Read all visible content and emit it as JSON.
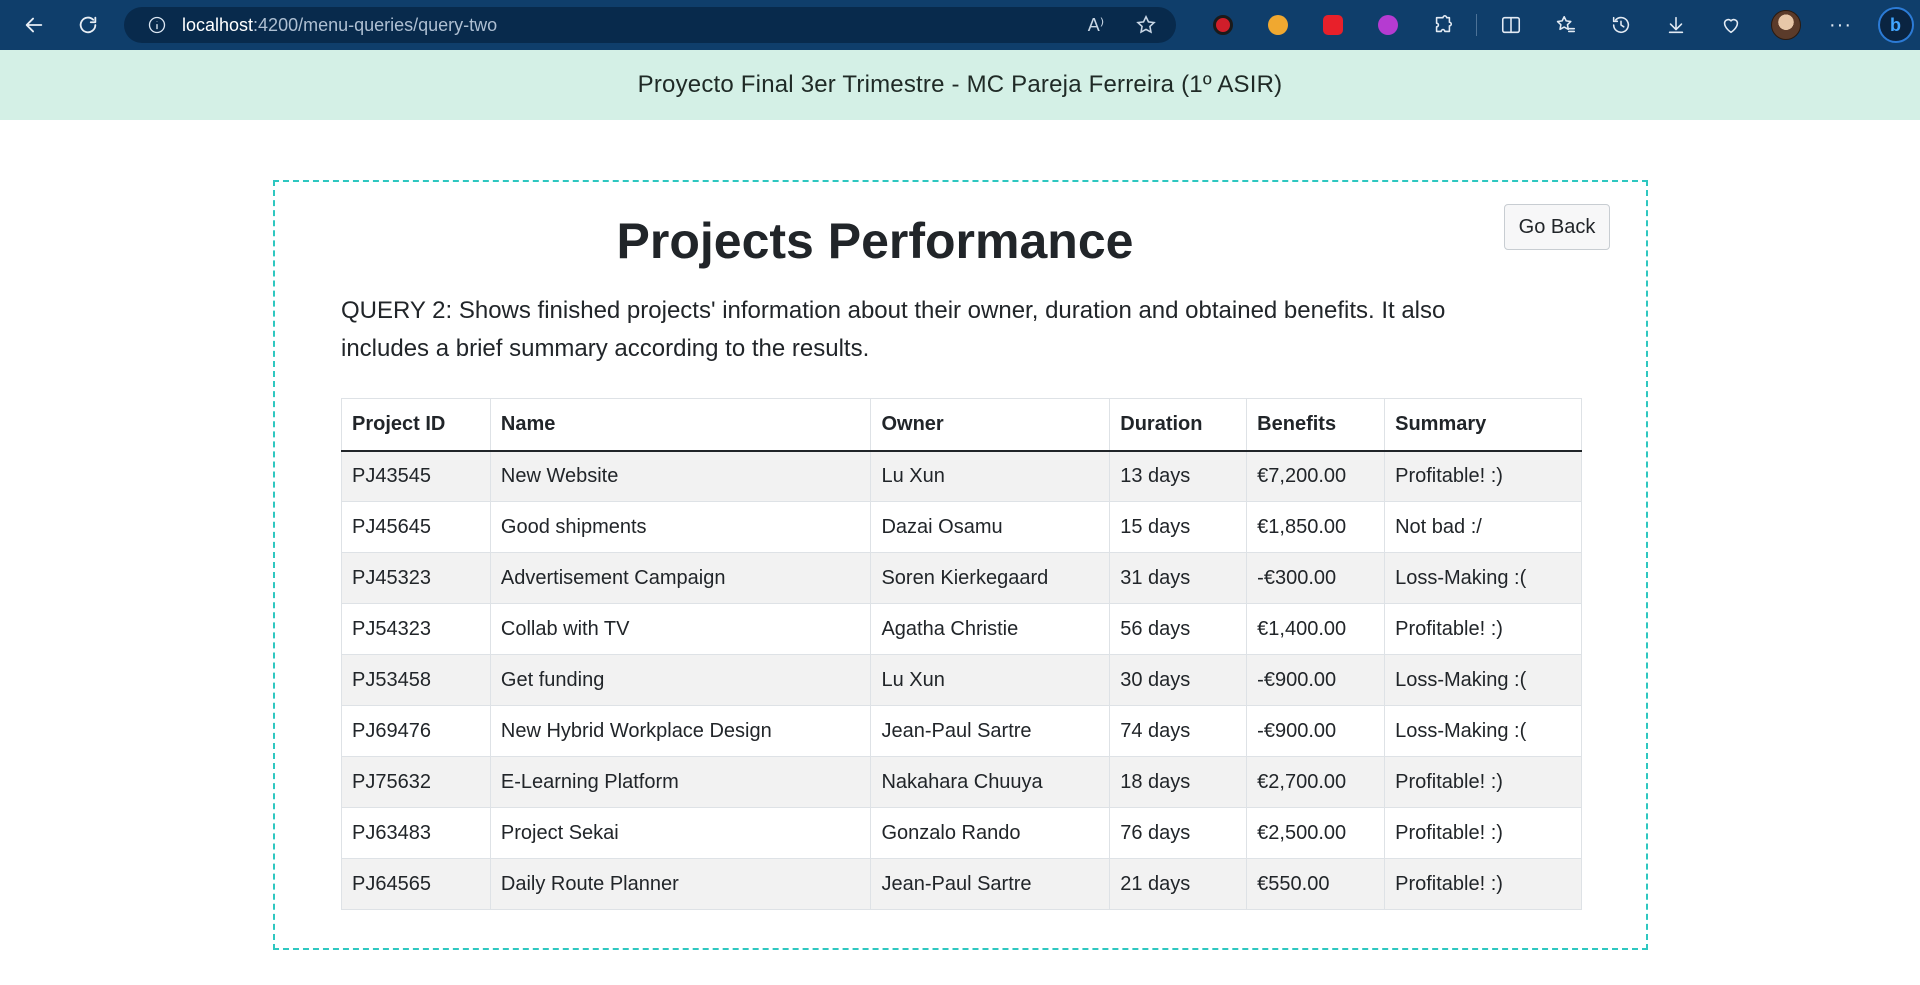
{
  "browser": {
    "url_host": "localhost",
    "url_path": ":4200/menu-queries/query-two",
    "more_label": "···",
    "read_aloud_glyph": "A⁾"
  },
  "header": {
    "title": "Proyecto Final 3er Trimestre - MC Pareja Ferreira (1º ASIR)"
  },
  "page": {
    "go_back_label": "Go Back",
    "title": "Projects Performance",
    "description": "QUERY 2: Shows finished projects' information about their owner, duration and obtained benefits. It also includes a brief summary according to the results."
  },
  "table": {
    "columns": [
      "Project ID",
      "Name",
      "Owner",
      "Duration",
      "Benefits",
      "Summary"
    ],
    "rows": [
      [
        "PJ43545",
        "New Website",
        "Lu Xun",
        "13 days",
        "€7,200.00",
        "Profitable! :)"
      ],
      [
        "PJ45645",
        "Good shipments",
        "Dazai Osamu",
        "15 days",
        "€1,850.00",
        "Not bad :/"
      ],
      [
        "PJ45323",
        "Advertisement Campaign",
        "Soren Kierkegaard",
        "31 days",
        "-€300.00",
        "Loss-Making :("
      ],
      [
        "PJ54323",
        "Collab with TV",
        "Agatha Christie",
        "56 days",
        "€1,400.00",
        "Profitable! :)"
      ],
      [
        "PJ53458",
        "Get funding",
        "Lu Xun",
        "30 days",
        "-€900.00",
        "Loss-Making :("
      ],
      [
        "PJ69476",
        "New Hybrid Workplace Design",
        "Jean-Paul Sartre",
        "74 days",
        "-€900.00",
        "Loss-Making :("
      ],
      [
        "PJ75632",
        "E-Learning Platform",
        "Nakahara Chuuya",
        "18 days",
        "€2,700.00",
        "Profitable! :)"
      ],
      [
        "PJ63483",
        "Project Sekai",
        "Gonzalo Rando",
        "76 days",
        "€2,500.00",
        "Profitable! :)"
      ],
      [
        "PJ64565",
        "Daily Route Planner",
        "Jean-Paul Sartre",
        "21 days",
        "€550.00",
        "Profitable! :)"
      ]
    ]
  },
  "colors": {
    "browser_bar": "#0f3e6b",
    "header_bg": "#d4f0e6",
    "card_border": "#2ec7c0"
  }
}
